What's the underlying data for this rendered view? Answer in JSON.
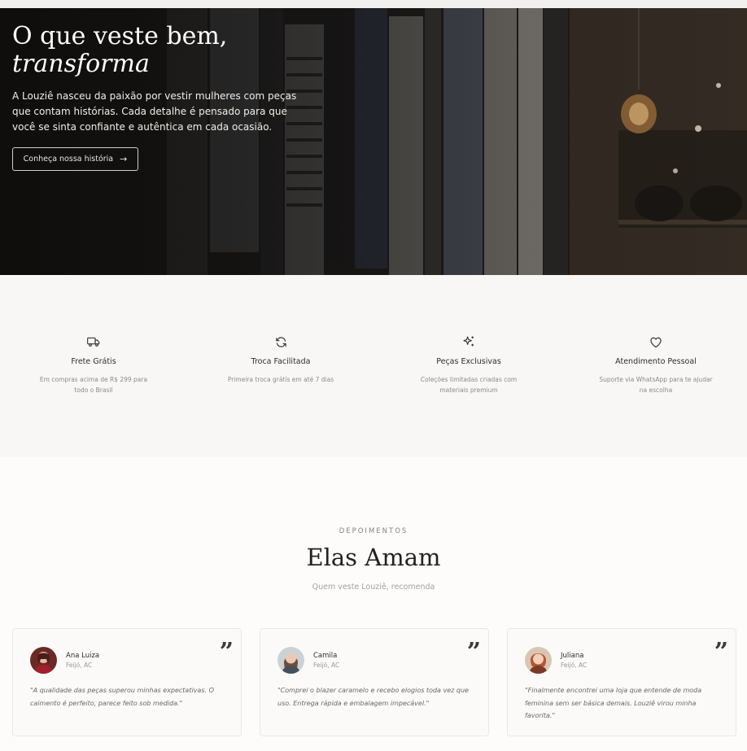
{
  "hero": {
    "title_line1": "O que veste bem,",
    "title_line2": "transforma",
    "text": "A Louziê nasceu da paixão por vestir mulheres com peças que contam histórias. Cada detalhe é pensado para que você se sinta confiante e autêntica em cada ocasião.",
    "button_label": "Conheça nossa história",
    "button_icon": "arrow-right-icon"
  },
  "features": [
    {
      "icon": "truck-icon",
      "title": "Frete Grátis",
      "desc": "Em compras acima de R$ 299 para todo o Brasil"
    },
    {
      "icon": "refresh-icon",
      "title": "Troca Facilitada",
      "desc": "Primeira troca grátis em até 7 dias"
    },
    {
      "icon": "sparkles-icon",
      "title": "Peças Exclusivas",
      "desc": "Coleções limitadas criadas com materiais premium"
    },
    {
      "icon": "heart-icon",
      "title": "Atendimento Pessoal",
      "desc": "Suporte via WhatsApp para te ajudar na escolha"
    }
  ],
  "testimonials": {
    "eyebrow": "DEPOIMENTOS",
    "title": "Elas Amam",
    "subtitle": "Quem veste Louziê, recomenda",
    "items": [
      {
        "name": "Ana Luiza",
        "place": "Feijó, AC",
        "quote": "\"A qualidade das peças superou minhas expectativas. O caimento é perfeito, parece feito sob medida.\""
      },
      {
        "name": "Camila",
        "place": "Feijó, AC",
        "quote": "\"Comprei o blazer caramelo e recebo elogios toda vez que uso. Entrega rápida e embalagem impecável.\""
      },
      {
        "name": "Juliana",
        "place": "Feijó, AC",
        "quote": "\"Finalmente encontrei uma loja que entende de moda feminina sem ser básica demais. Louziê virou minha favorita.\""
      }
    ],
    "quote_icon": "quote-icon"
  }
}
